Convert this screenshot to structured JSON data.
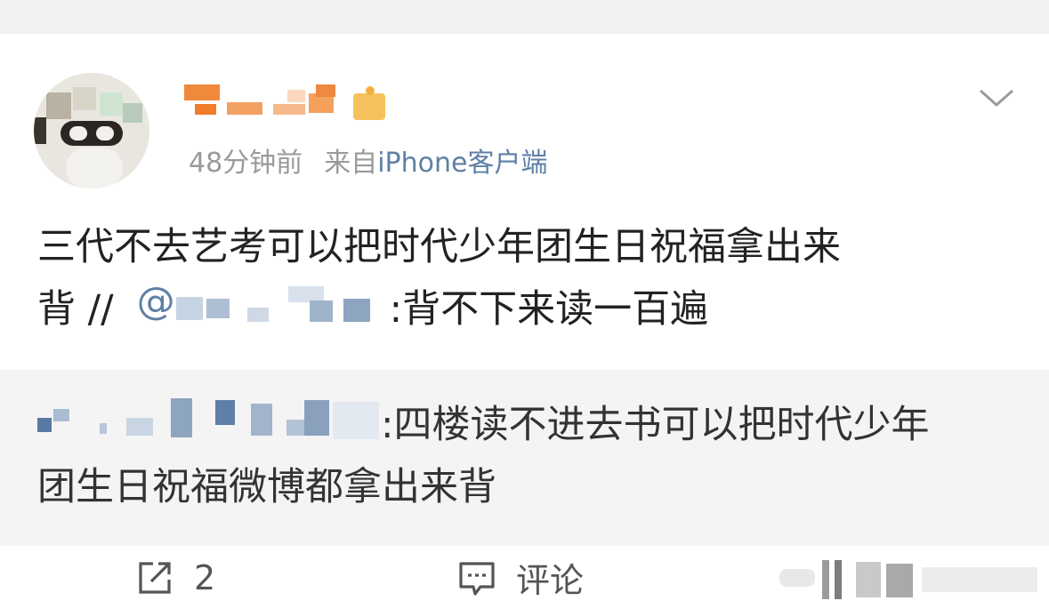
{
  "post": {
    "time": "48分钟前",
    "source_prefix": "来自",
    "source": "iPhone客户端",
    "text_line1": "三代不去艺考可以把时代少年团生日祝福拿出来",
    "text_line2_before": "背 //",
    "mention_at": "@",
    "text_line2_after": ":背不下来读一百遍"
  },
  "repost": {
    "text_after_author": ":四楼读不进去书可以把时代少年",
    "text_line2": "团生日祝福微博都拿出来背"
  },
  "actions": {
    "repost_count": "2",
    "comment_label": "评论"
  },
  "icons": {
    "more": "chevron-down-icon",
    "repost": "share-icon",
    "comment": "comment-icon"
  },
  "colors": {
    "link": "#5f7fa6",
    "meta": "#9a9a9a",
    "text": "#222222",
    "repost_bg": "#f4f4f4"
  }
}
